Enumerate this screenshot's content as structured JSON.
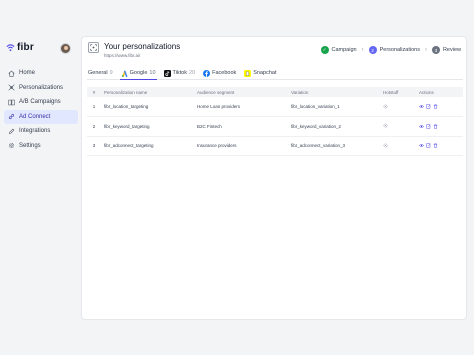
{
  "brand": {
    "name": "fibr"
  },
  "sidebar": {
    "items": [
      {
        "label": "Home",
        "icon": "home-icon",
        "active": false
      },
      {
        "label": "Personalizations",
        "icon": "crosshair-icon",
        "active": false
      },
      {
        "label": "A/B Campaigns",
        "icon": "ab-icon",
        "active": false
      },
      {
        "label": "Ad Connect",
        "icon": "link-icon",
        "active": true
      },
      {
        "label": "Integrations",
        "icon": "pencil-icon",
        "active": false
      },
      {
        "label": "Settings",
        "icon": "gear-icon",
        "active": false
      }
    ]
  },
  "header": {
    "title": "Your personalizations",
    "url": "https://www.fibr.ai/"
  },
  "steps": [
    {
      "label": "Campaign",
      "marker": "✓",
      "state": "done"
    },
    {
      "label": "Personalizations",
      "marker": "2",
      "state": "current"
    },
    {
      "label": "Review",
      "marker": "3",
      "state": "todo"
    }
  ],
  "tabs": [
    {
      "label": "General",
      "count": "9",
      "icon": "",
      "active": false
    },
    {
      "label": "Google",
      "count": "10",
      "icon": "google-ads-icon",
      "active": true
    },
    {
      "label": "Tiktok",
      "count": "20",
      "icon": "tiktok-icon",
      "active": false
    },
    {
      "label": "Facebook",
      "count": "",
      "icon": "facebook-icon",
      "active": false
    },
    {
      "label": "Snapchat",
      "count": "",
      "icon": "snapchat-icon",
      "active": false
    }
  ],
  "table": {
    "headers": [
      "#",
      "Personalization name",
      "Audience segment",
      "Variation",
      "Hotstuff",
      "Actions"
    ],
    "rows": [
      {
        "num": "1",
        "name": "fibr_location_targeting",
        "audience": "Home Loan providers",
        "variation": "fibr_location_variation_1"
      },
      {
        "num": "2",
        "name": "fibr_keyword_targeting",
        "audience": "B2C Fintech",
        "variation": "fibr_keyword_variation_2"
      },
      {
        "num": "3",
        "name": "fibr_adconnect_targeting",
        "audience": "Insurance providers",
        "variation": "fibr_adconnect_variation_3"
      }
    ]
  },
  "colors": {
    "accent": "#4f46e5",
    "active_nav_bg": "#e0e7ff",
    "step_done": "#16a34a",
    "step_current": "#6366f1"
  }
}
